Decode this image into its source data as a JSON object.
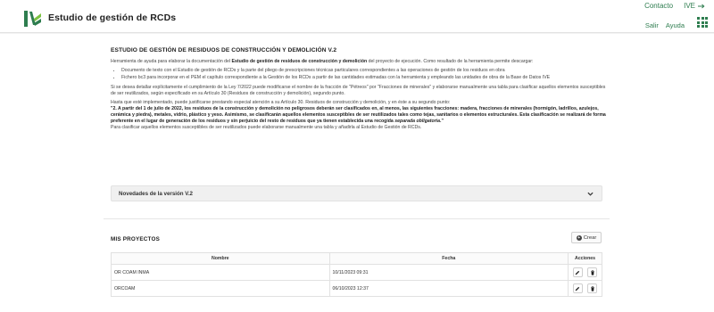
{
  "header": {
    "app_title": "Estudio de gestión de RCDs",
    "contact_label": "Contacto",
    "ive_label": "IVE",
    "logout_label": "Salir",
    "help_label": "Ayuda"
  },
  "intro": {
    "heading": "ESTUDIO DE GESTIÓN DE RESIDUOS DE CONSTRUCCIÓN Y DEMOLICIÓN V.2",
    "p1_a": "Herramienta de ayuda para elaborar la documentación del ",
    "p1_b": "Estudio de gestión de residuos de construcción y demolición",
    "p1_c": " del proyecto de ejecución. Como resultado de la herramienta permite descargar:",
    "bullets": [
      "Documento de texto con el Estudio de gestión de RCDs y la parte del pliego de prescripciones técnicas particulares correspondientes a las operaciones de gestión de los residuos en obra",
      "Fichero bc3 para incorporar en el PEM el capítulo correspondiente a la Gestión de los RCDs a partir de las cantidades estimadas con la herramienta y empleando las unidades de obra de la Base de Datos IVE"
    ],
    "p2": "Si se desea detallar explícitamente el cumplimiento de la Ley 7/2022 puede modificarse el nombre de la fracción de \"Pétreos\" por \"Fracciones de minerales\" y elaborarse manualmente una tabla para clasificar aquellos elementos susceptibles de ser reutilizados, según especificado en su Artículo 30 (Residuos de construcción y demolición), segundo punto.",
    "p3": "Hasta que esté implementado, puede justificarse prestando especial atención a su Artículo 30. Residuos de construcción y demolición, y en éste a su segundo punto:",
    "quote_a": "\"2. A partir del 1 de julio de 2022, los residuos de la construcción y demolición no peligrosos deberán ser clasificados en, al menos, las siguientes fracciones: madera, fracciones de minerales (hormigón, ladrillos, azulejos, cerámica y piedra), metales, vidrio, plástico y yeso. Asimismo, se clasificarán aquellos elementos susceptibles de ser reutilizados tales como tejas, sanitarios o elementos estructurales. Esta clasificación se realizará de forma preferente en el lugar de generación de los residuos y sin perjuicio del resto de residuos que ya tienen establecida una recogida ",
    "quote_em": "separada obligatoria",
    "quote_b": ".\"",
    "p4": "Para clasificar aquellos elementos susceptibles de ser reutilizados puede elaborarse manualmente una tabla y añadirla al Estudio de Gestión de RCDs."
  },
  "accordion": {
    "title": "Novedades de la versión V.2"
  },
  "projects": {
    "title": "MIS PROYECTOS",
    "create_label": "Crear",
    "columns": [
      "Nombre",
      "Fecha",
      "Acciones"
    ],
    "rows": [
      {
        "name": "OR COAM INMA",
        "date": "10/11/2023 09:31"
      },
      {
        "name": "ORCOAM",
        "date": "06/10/2023 12:37"
      }
    ]
  },
  "colors": {
    "brand": "#2e7d4f",
    "header_bg": "#ffffff",
    "page_bg": "#f2f2f2"
  },
  "icons": {
    "logo": "ive-logo",
    "ive_arrow": "arrow-right-icon",
    "apps": "grid-icon",
    "accordion": "chevron-down-icon",
    "create": "plus-circle-icon",
    "edit": "pencil-icon",
    "delete": "trash-icon"
  }
}
